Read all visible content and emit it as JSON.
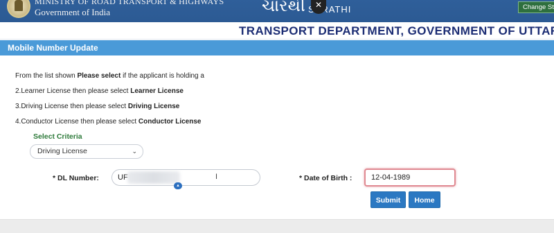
{
  "header": {
    "ministry": "MINISTRY OF ROAD TRANSPORT & HIGHWAYS",
    "government": "Government of India",
    "brand_script": "ચારથી",
    "brand_name": "SARATHI",
    "change_state_label": "Change St"
  },
  "close_label": "✕",
  "department_title": "TRANSPORT DEPARTMENT, GOVERNMENT OF UTTAR PRADE",
  "panel": {
    "title": "Mobile Number Update",
    "instructions": {
      "intro_before": "From the list shown ",
      "intro_bold": "Please select",
      "intro_after": " if the applicant is holding a",
      "line2_before": "2.Learner License then please select ",
      "line2_bold": "Learner License",
      "line3_before": "3.Driving License then please select ",
      "line3_bold": "Driving License",
      "line4_before": "4.Conductor License then please select ",
      "line4_bold": "Conductor License"
    },
    "criteria_label": "Select Criteria",
    "criteria_selected": "Driving License",
    "dl_label": "* DL Number:",
    "dl_value": "UF",
    "dob_label": "* Date of Birth :",
    "dob_value": "12-04-1989",
    "submit_label": "Submit",
    "home_label": "Home"
  },
  "colors": {
    "header_bg": "#2f5f9a",
    "panel_head_bg": "#4a9ad8",
    "dept_title": "#1c2d74",
    "criteria_label": "#2d7a3a",
    "button_bg": "#2b78c2",
    "dob_highlight": "#e08a92"
  },
  "icons": {
    "emblem": "national-emblem-icon",
    "close": "close-icon",
    "chevron": "chevron-down-icon",
    "cursor": "text-cursor-icon"
  }
}
